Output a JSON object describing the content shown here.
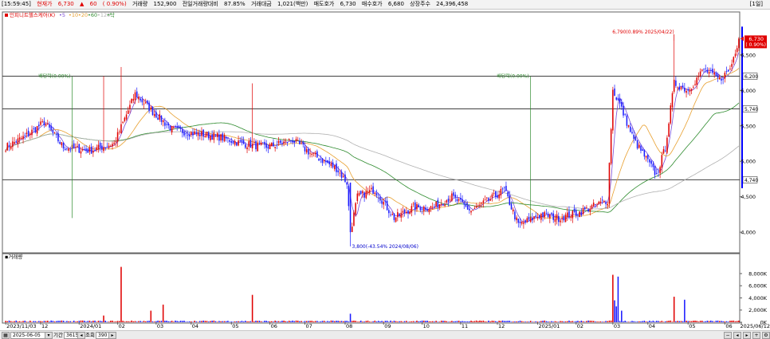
{
  "header": {
    "time": "[15:59:45]",
    "label_current": "현재가",
    "price": "6,730",
    "arrow": "▲",
    "change": "60",
    "change_pct": "( 0.90%)",
    "volume_label": "거래량",
    "volume": "152,900",
    "prev_vol_ratio_label": "전일거래량대비",
    "prev_vol_ratio": "87.85%",
    "amount_label": "거래대금",
    "amount": "1,021(백만)",
    "ask_label": "매도호가",
    "ask": "6,730",
    "bid_label": "매수호가",
    "bid": "6,680",
    "shares_label": "상장주수",
    "shares": "24,396,458",
    "period": "[1일]"
  },
  "colors": {
    "up": "#e00000",
    "down": "#1a1aff",
    "ma5": "#7b4bd6",
    "ma20": "#e8a030",
    "ma60": "#2e8b2e",
    "ma120": "#b0b0b0",
    "axis_bar": "#0000ff"
  },
  "chart_data": [
    {
      "type": "candlestick",
      "legend": "인피니트헬스케어(K)",
      "ma_labels": [
        "5",
        "10",
        "20",
        "60",
        "120",
        "탁"
      ],
      "y_ticks": [
        4000,
        4500,
        5000,
        5500,
        6000,
        6500
      ],
      "y_tick_labels": [
        "4,000",
        "4,500",
        "5,000",
        "5,500",
        "6,000",
        "6,500"
      ],
      "ylim": [
        3720,
        7050
      ],
      "x_ticks": [
        {
          "label": "2023/11/03",
          "date": "2023-11-03"
        },
        {
          "label": "12",
          "date": "2023-12-01"
        },
        {
          "label": "2024/01",
          "date": "2024-01-02"
        },
        {
          "label": "02",
          "date": "2024-02-01"
        },
        {
          "label": "03",
          "date": "2024-03-04"
        },
        {
          "label": "04",
          "date": "2024-04-01"
        },
        {
          "label": "05",
          "date": "2024-05-02"
        },
        {
          "label": "06",
          "date": "2024-06-03"
        },
        {
          "label": "07",
          "date": "2024-07-01"
        },
        {
          "label": "08",
          "date": "2024-08-01"
        },
        {
          "label": "09",
          "date": "2024-09-02"
        },
        {
          "label": "10",
          "date": "2024-10-02"
        },
        {
          "label": "11",
          "date": "2024-11-01"
        },
        {
          "label": "12",
          "date": "2024-12-02"
        },
        {
          "label": "2025/01",
          "date": "2025-01-02"
        },
        {
          "label": "02",
          "date": "2025-02-03"
        },
        {
          "label": "03",
          "date": "2025-03-04"
        },
        {
          "label": "04",
          "date": "2025-04-01"
        },
        {
          "label": "05",
          "date": "2025-05-02"
        },
        {
          "label": "06",
          "date": "2025-06-02"
        },
        {
          "label": "2025/06/12",
          "date": "2025-06-12"
        }
      ],
      "horizontal_lines": [
        {
          "value": 6200,
          "label": "6,200"
        },
        {
          "value": 5740,
          "label": "5,740"
        },
        {
          "value": 4740,
          "label": "4,740"
        }
      ],
      "current_price_label": "6,730",
      "current_price_value": 6730,
      "current_change_label": "( 0.90%)",
      "annotations": [
        {
          "text": "배당락(0.00%)",
          "date": "2023-12-27"
        },
        {
          "text": "배당락(0.00%)",
          "date": "2024-12-27"
        },
        {
          "text": "6,790(0.89% 2025/04/22)",
          "date": "2025-04-22",
          "value": 6790
        },
        {
          "text": "3,800(-43.54% 2024/08/06)",
          "date": "2024-08-06",
          "value": 3800
        }
      ],
      "close_keyframes": [
        [
          "2023-11-03",
          5200
        ],
        [
          "2023-11-20",
          5350
        ],
        [
          "2023-12-05",
          5550
        ],
        [
          "2023-12-20",
          5200
        ],
        [
          "2024-01-10",
          5150
        ],
        [
          "2024-01-30",
          5250
        ],
        [
          "2024-02-15",
          5950
        ],
        [
          "2024-02-29",
          5700
        ],
        [
          "2024-03-15",
          5450
        ],
        [
          "2024-04-01",
          5400
        ],
        [
          "2024-04-20",
          5350
        ],
        [
          "2024-05-10",
          5250
        ],
        [
          "2024-05-30",
          5200
        ],
        [
          "2024-06-20",
          5300
        ],
        [
          "2024-07-05",
          5100
        ],
        [
          "2024-07-25",
          4900
        ],
        [
          "2024-08-02",
          4700
        ],
        [
          "2024-08-06",
          4000
        ],
        [
          "2024-08-12",
          4500
        ],
        [
          "2024-08-25",
          4600
        ],
        [
          "2024-09-10",
          4200
        ],
        [
          "2024-09-25",
          4350
        ],
        [
          "2024-10-10",
          4350
        ],
        [
          "2024-10-25",
          4500
        ],
        [
          "2024-11-10",
          4300
        ],
        [
          "2024-11-25",
          4450
        ],
        [
          "2024-12-06",
          4600
        ],
        [
          "2024-12-18",
          4100
        ],
        [
          "2025-01-05",
          4250
        ],
        [
          "2025-01-20",
          4200
        ],
        [
          "2025-02-05",
          4280
        ],
        [
          "2025-02-20",
          4400
        ],
        [
          "2025-02-27",
          4450
        ],
        [
          "2025-03-04",
          6000
        ],
        [
          "2025-03-10",
          5800
        ],
        [
          "2025-03-20",
          5300
        ],
        [
          "2025-04-01",
          5000
        ],
        [
          "2025-04-08",
          4800
        ],
        [
          "2025-04-15",
          5200
        ],
        [
          "2025-04-22",
          6100
        ],
        [
          "2025-05-02",
          6000
        ],
        [
          "2025-05-15",
          6300
        ],
        [
          "2025-05-28",
          6150
        ],
        [
          "2025-06-05",
          6300
        ],
        [
          "2025-06-12",
          6730
        ]
      ],
      "high_overrides": [
        [
          "2024-01-22",
          6200
        ],
        [
          "2024-02-05",
          6330
        ],
        [
          "2024-05-20",
          6100
        ],
        [
          "2025-04-22",
          6790
        ]
      ],
      "low_overrides": [
        [
          "2024-08-06",
          3800
        ]
      ]
    },
    {
      "type": "bar",
      "legend": "거래량",
      "y_ticks": [
        0,
        2000,
        4000,
        6000,
        8000
      ],
      "y_tick_labels": [
        "0K",
        "2,000K",
        "4,000K",
        "6,000K",
        "8,000K"
      ],
      "ylim": [
        0,
        9700
      ],
      "unit": "K",
      "spikes": [
        [
          "2024-02-05",
          9100
        ],
        [
          "2024-03-08",
          2900
        ],
        [
          "2024-02-28",
          1900
        ],
        [
          "2024-05-20",
          4500
        ],
        [
          "2024-08-06",
          1400
        ],
        [
          "2024-01-22",
          1100
        ],
        [
          "2025-03-04",
          7800
        ],
        [
          "2025-03-05",
          3600
        ],
        [
          "2025-03-06",
          2600
        ],
        [
          "2025-03-07",
          7500
        ],
        [
          "2025-03-11",
          1900
        ],
        [
          "2025-04-22",
          4200
        ],
        [
          "2025-04-30",
          3700
        ],
        [
          "2025-06-12",
          270
        ]
      ],
      "base_volume": 180
    }
  ],
  "bottombar": {
    "date": "2025-06-05",
    "period_label": "기간",
    "period": "3615",
    "count_label": "조회",
    "count": "390"
  }
}
